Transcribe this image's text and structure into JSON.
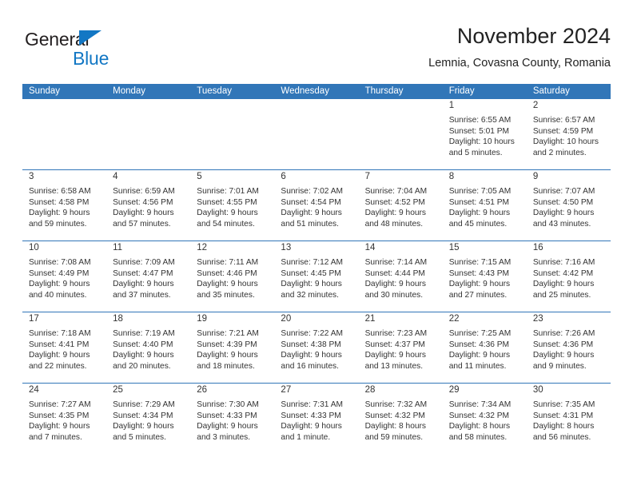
{
  "brand": {
    "name_top": "General",
    "name_bottom": "Blue",
    "accent_color": "#1277c4"
  },
  "header": {
    "title": "November 2024",
    "subtitle": "Lemnia, Covasna County, Romania"
  },
  "theme": {
    "header_blue": "#3176b8",
    "date_strip_gray": "#eeeeee",
    "text": "#333333"
  },
  "weekdays": [
    "Sunday",
    "Monday",
    "Tuesday",
    "Wednesday",
    "Thursday",
    "Friday",
    "Saturday"
  ],
  "weeks": [
    [
      {
        "day": "",
        "sunrise": "",
        "sunset": "",
        "daylight": "",
        "daylight2": ""
      },
      {
        "day": "",
        "sunrise": "",
        "sunset": "",
        "daylight": "",
        "daylight2": ""
      },
      {
        "day": "",
        "sunrise": "",
        "sunset": "",
        "daylight": "",
        "daylight2": ""
      },
      {
        "day": "",
        "sunrise": "",
        "sunset": "",
        "daylight": "",
        "daylight2": ""
      },
      {
        "day": "",
        "sunrise": "",
        "sunset": "",
        "daylight": "",
        "daylight2": ""
      },
      {
        "day": "1",
        "sunrise": "Sunrise: 6:55 AM",
        "sunset": "Sunset: 5:01 PM",
        "daylight": "Daylight: 10 hours",
        "daylight2": "and 5 minutes."
      },
      {
        "day": "2",
        "sunrise": "Sunrise: 6:57 AM",
        "sunset": "Sunset: 4:59 PM",
        "daylight": "Daylight: 10 hours",
        "daylight2": "and 2 minutes."
      }
    ],
    [
      {
        "day": "3",
        "sunrise": "Sunrise: 6:58 AM",
        "sunset": "Sunset: 4:58 PM",
        "daylight": "Daylight: 9 hours",
        "daylight2": "and 59 minutes."
      },
      {
        "day": "4",
        "sunrise": "Sunrise: 6:59 AM",
        "sunset": "Sunset: 4:56 PM",
        "daylight": "Daylight: 9 hours",
        "daylight2": "and 57 minutes."
      },
      {
        "day": "5",
        "sunrise": "Sunrise: 7:01 AM",
        "sunset": "Sunset: 4:55 PM",
        "daylight": "Daylight: 9 hours",
        "daylight2": "and 54 minutes."
      },
      {
        "day": "6",
        "sunrise": "Sunrise: 7:02 AM",
        "sunset": "Sunset: 4:54 PM",
        "daylight": "Daylight: 9 hours",
        "daylight2": "and 51 minutes."
      },
      {
        "day": "7",
        "sunrise": "Sunrise: 7:04 AM",
        "sunset": "Sunset: 4:52 PM",
        "daylight": "Daylight: 9 hours",
        "daylight2": "and 48 minutes."
      },
      {
        "day": "8",
        "sunrise": "Sunrise: 7:05 AM",
        "sunset": "Sunset: 4:51 PM",
        "daylight": "Daylight: 9 hours",
        "daylight2": "and 45 minutes."
      },
      {
        "day": "9",
        "sunrise": "Sunrise: 7:07 AM",
        "sunset": "Sunset: 4:50 PM",
        "daylight": "Daylight: 9 hours",
        "daylight2": "and 43 minutes."
      }
    ],
    [
      {
        "day": "10",
        "sunrise": "Sunrise: 7:08 AM",
        "sunset": "Sunset: 4:49 PM",
        "daylight": "Daylight: 9 hours",
        "daylight2": "and 40 minutes."
      },
      {
        "day": "11",
        "sunrise": "Sunrise: 7:09 AM",
        "sunset": "Sunset: 4:47 PM",
        "daylight": "Daylight: 9 hours",
        "daylight2": "and 37 minutes."
      },
      {
        "day": "12",
        "sunrise": "Sunrise: 7:11 AM",
        "sunset": "Sunset: 4:46 PM",
        "daylight": "Daylight: 9 hours",
        "daylight2": "and 35 minutes."
      },
      {
        "day": "13",
        "sunrise": "Sunrise: 7:12 AM",
        "sunset": "Sunset: 4:45 PM",
        "daylight": "Daylight: 9 hours",
        "daylight2": "and 32 minutes."
      },
      {
        "day": "14",
        "sunrise": "Sunrise: 7:14 AM",
        "sunset": "Sunset: 4:44 PM",
        "daylight": "Daylight: 9 hours",
        "daylight2": "and 30 minutes."
      },
      {
        "day": "15",
        "sunrise": "Sunrise: 7:15 AM",
        "sunset": "Sunset: 4:43 PM",
        "daylight": "Daylight: 9 hours",
        "daylight2": "and 27 minutes."
      },
      {
        "day": "16",
        "sunrise": "Sunrise: 7:16 AM",
        "sunset": "Sunset: 4:42 PM",
        "daylight": "Daylight: 9 hours",
        "daylight2": "and 25 minutes."
      }
    ],
    [
      {
        "day": "17",
        "sunrise": "Sunrise: 7:18 AM",
        "sunset": "Sunset: 4:41 PM",
        "daylight": "Daylight: 9 hours",
        "daylight2": "and 22 minutes."
      },
      {
        "day": "18",
        "sunrise": "Sunrise: 7:19 AM",
        "sunset": "Sunset: 4:40 PM",
        "daylight": "Daylight: 9 hours",
        "daylight2": "and 20 minutes."
      },
      {
        "day": "19",
        "sunrise": "Sunrise: 7:21 AM",
        "sunset": "Sunset: 4:39 PM",
        "daylight": "Daylight: 9 hours",
        "daylight2": "and 18 minutes."
      },
      {
        "day": "20",
        "sunrise": "Sunrise: 7:22 AM",
        "sunset": "Sunset: 4:38 PM",
        "daylight": "Daylight: 9 hours",
        "daylight2": "and 16 minutes."
      },
      {
        "day": "21",
        "sunrise": "Sunrise: 7:23 AM",
        "sunset": "Sunset: 4:37 PM",
        "daylight": "Daylight: 9 hours",
        "daylight2": "and 13 minutes."
      },
      {
        "day": "22",
        "sunrise": "Sunrise: 7:25 AM",
        "sunset": "Sunset: 4:36 PM",
        "daylight": "Daylight: 9 hours",
        "daylight2": "and 11 minutes."
      },
      {
        "day": "23",
        "sunrise": "Sunrise: 7:26 AM",
        "sunset": "Sunset: 4:36 PM",
        "daylight": "Daylight: 9 hours",
        "daylight2": "and 9 minutes."
      }
    ],
    [
      {
        "day": "24",
        "sunrise": "Sunrise: 7:27 AM",
        "sunset": "Sunset: 4:35 PM",
        "daylight": "Daylight: 9 hours",
        "daylight2": "and 7 minutes."
      },
      {
        "day": "25",
        "sunrise": "Sunrise: 7:29 AM",
        "sunset": "Sunset: 4:34 PM",
        "daylight": "Daylight: 9 hours",
        "daylight2": "and 5 minutes."
      },
      {
        "day": "26",
        "sunrise": "Sunrise: 7:30 AM",
        "sunset": "Sunset: 4:33 PM",
        "daylight": "Daylight: 9 hours",
        "daylight2": "and 3 minutes."
      },
      {
        "day": "27",
        "sunrise": "Sunrise: 7:31 AM",
        "sunset": "Sunset: 4:33 PM",
        "daylight": "Daylight: 9 hours",
        "daylight2": "and 1 minute."
      },
      {
        "day": "28",
        "sunrise": "Sunrise: 7:32 AM",
        "sunset": "Sunset: 4:32 PM",
        "daylight": "Daylight: 8 hours",
        "daylight2": "and 59 minutes."
      },
      {
        "day": "29",
        "sunrise": "Sunrise: 7:34 AM",
        "sunset": "Sunset: 4:32 PM",
        "daylight": "Daylight: 8 hours",
        "daylight2": "and 58 minutes."
      },
      {
        "day": "30",
        "sunrise": "Sunrise: 7:35 AM",
        "sunset": "Sunset: 4:31 PM",
        "daylight": "Daylight: 8 hours",
        "daylight2": "and 56 minutes."
      }
    ]
  ]
}
